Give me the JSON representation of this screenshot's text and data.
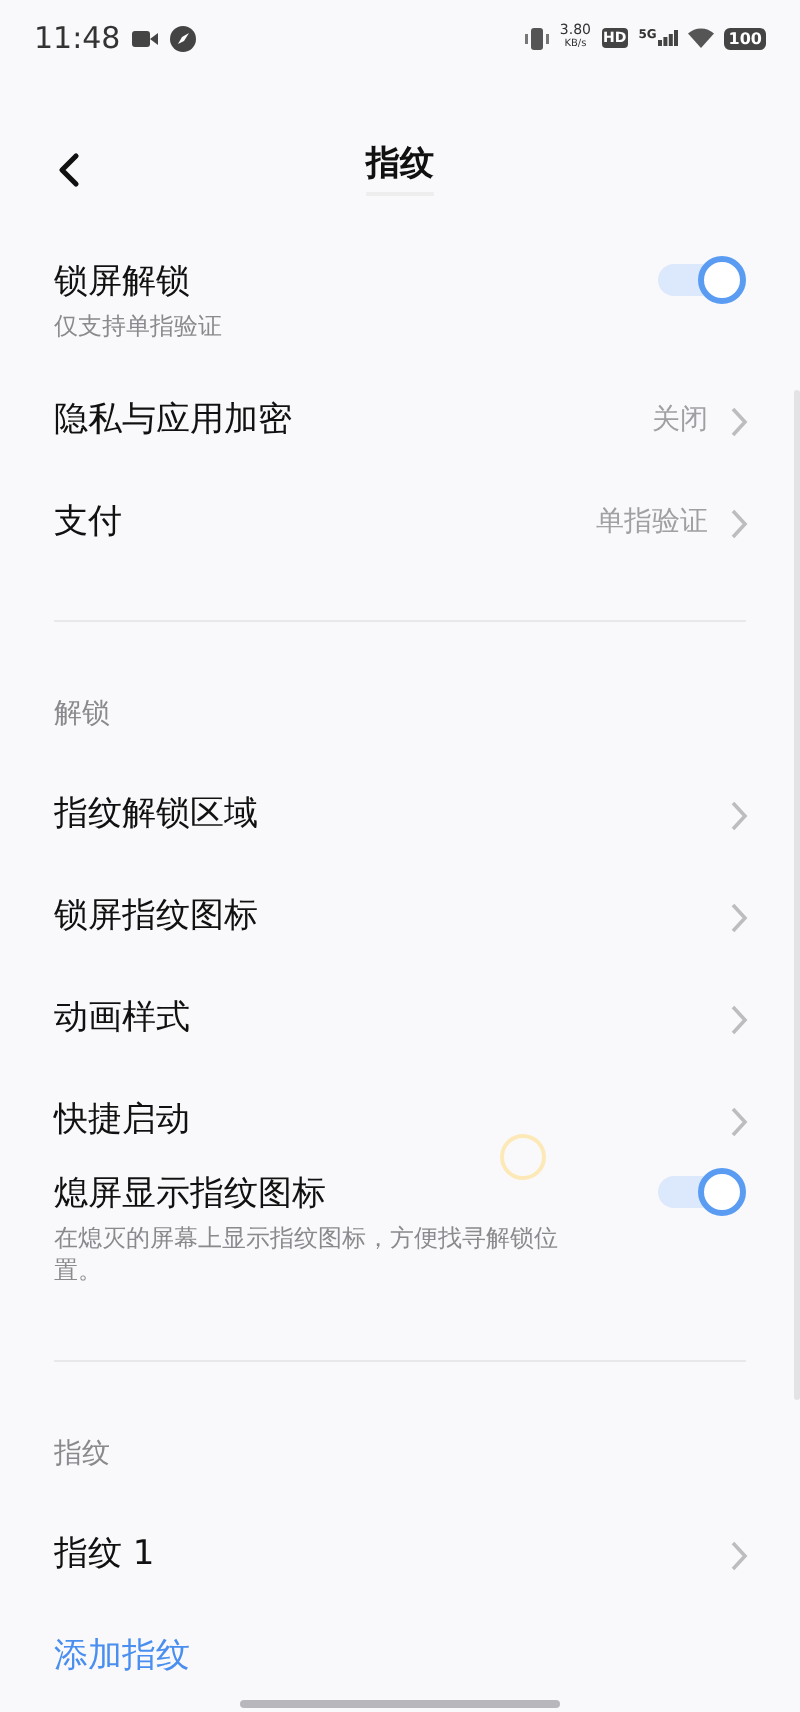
{
  "status_bar": {
    "time": "11:48",
    "speed_value": "3.80",
    "speed_unit": "KB/s",
    "hd_badge": "HD",
    "network": "5G",
    "battery": "100"
  },
  "header": {
    "title": "指纹"
  },
  "sections": [
    {
      "items": [
        {
          "kind": "toggle",
          "title": "锁屏解锁",
          "subtitle": "仅支持单指验证",
          "on": true
        },
        {
          "kind": "link",
          "title": "隐私与应用加密",
          "value": "关闭"
        },
        {
          "kind": "link",
          "title": "支付",
          "value": "单指验证"
        }
      ]
    },
    {
      "heading": "解锁",
      "items": [
        {
          "kind": "link",
          "title": "指纹解锁区域"
        },
        {
          "kind": "link",
          "title": "锁屏指纹图标"
        },
        {
          "kind": "link",
          "title": "动画样式"
        },
        {
          "kind": "link",
          "title": "快捷启动"
        },
        {
          "kind": "toggle",
          "title": "熄屏显示指纹图标",
          "subtitle": "在熄灭的屏幕上显示指纹图标，方便找寻解锁位置。",
          "on": true
        }
      ]
    },
    {
      "heading": "指纹",
      "items": [
        {
          "kind": "link",
          "title": "指纹 1"
        },
        {
          "kind": "action",
          "title": "添加指纹"
        }
      ]
    }
  ]
}
